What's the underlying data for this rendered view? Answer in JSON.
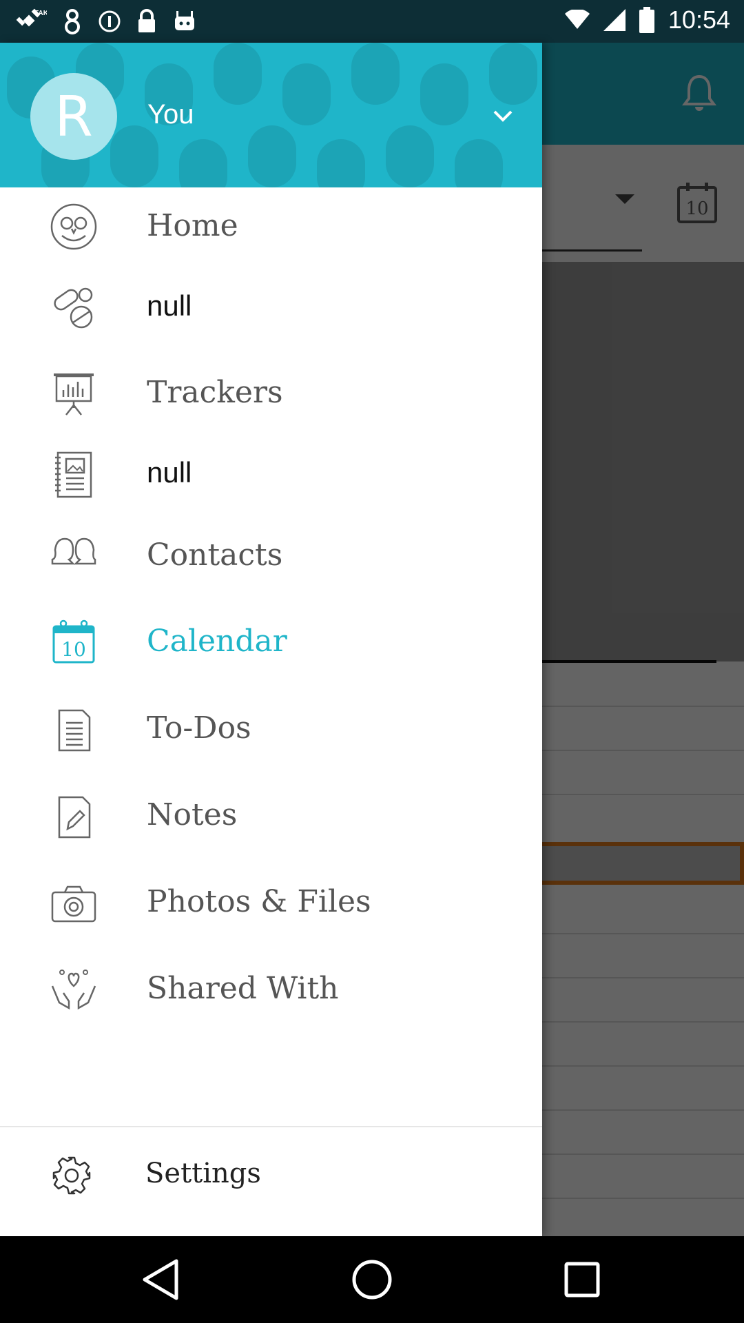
{
  "status_bar": {
    "time": "10:54",
    "icons": [
      "fake-gps-icon",
      "guitar-app-icon",
      "info-icon",
      "lock-icon",
      "android-icon",
      "wifi-icon",
      "signal-icon",
      "battery-icon"
    ]
  },
  "background": {
    "calendar_day": "10"
  },
  "drawer": {
    "avatar_letter": "R",
    "user_name": "You",
    "accent_color": "#1fb5c9",
    "items": [
      {
        "label": "Home",
        "icon": "owl-icon"
      },
      {
        "label": "null",
        "icon": "pills-icon"
      },
      {
        "label": "Trackers",
        "icon": "chart-board-icon"
      },
      {
        "label": "null",
        "icon": "journal-icon"
      },
      {
        "label": "Contacts",
        "icon": "contacts-icon"
      },
      {
        "label": "Calendar",
        "icon": "calendar-icon",
        "active": true,
        "day": "10"
      },
      {
        "label": "To-Dos",
        "icon": "document-list-icon"
      },
      {
        "label": "Notes",
        "icon": "note-pencil-icon"
      },
      {
        "label": "Photos & Files",
        "icon": "camera-icon"
      },
      {
        "label": "Shared With",
        "icon": "hands-heart-icon"
      }
    ],
    "settings_label": "Settings"
  }
}
